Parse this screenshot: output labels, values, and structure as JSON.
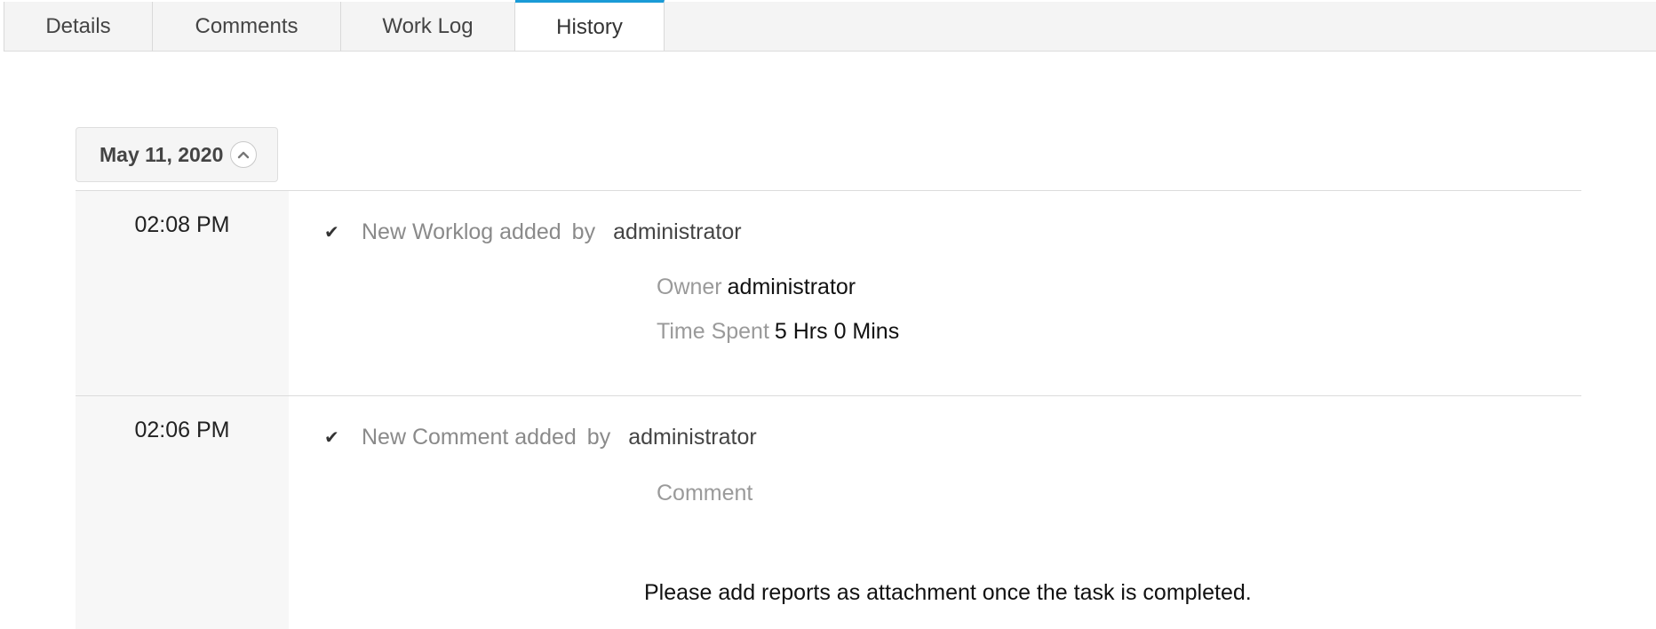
{
  "tabs": [
    {
      "label": "Details"
    },
    {
      "label": "Comments"
    },
    {
      "label": "Work Log"
    },
    {
      "label": "History",
      "active": true
    }
  ],
  "date_group": {
    "label": "May 11, 2020",
    "collapse_icon": "chevron-up-icon"
  },
  "entries": [
    {
      "time": "02:08 PM",
      "action": "New Worklog added",
      "by_label": "by",
      "user": "administrator",
      "fields": [
        {
          "label": "Owner",
          "value": "administrator"
        },
        {
          "label": "Time Spent",
          "value": "5 Hrs 0 Mins"
        }
      ]
    },
    {
      "time": "02:06 PM",
      "action": "New Comment added",
      "by_label": "by",
      "user": "administrator",
      "fields": [
        {
          "label": "Comment",
          "value": ""
        }
      ],
      "comment_text": "Please add reports as attachment once the task is completed."
    }
  ],
  "colors": {
    "active_tab_accent": "#1a9bd7",
    "tab_bar_bg": "#f4f4f4",
    "time_col_bg": "#f7f7f7"
  }
}
